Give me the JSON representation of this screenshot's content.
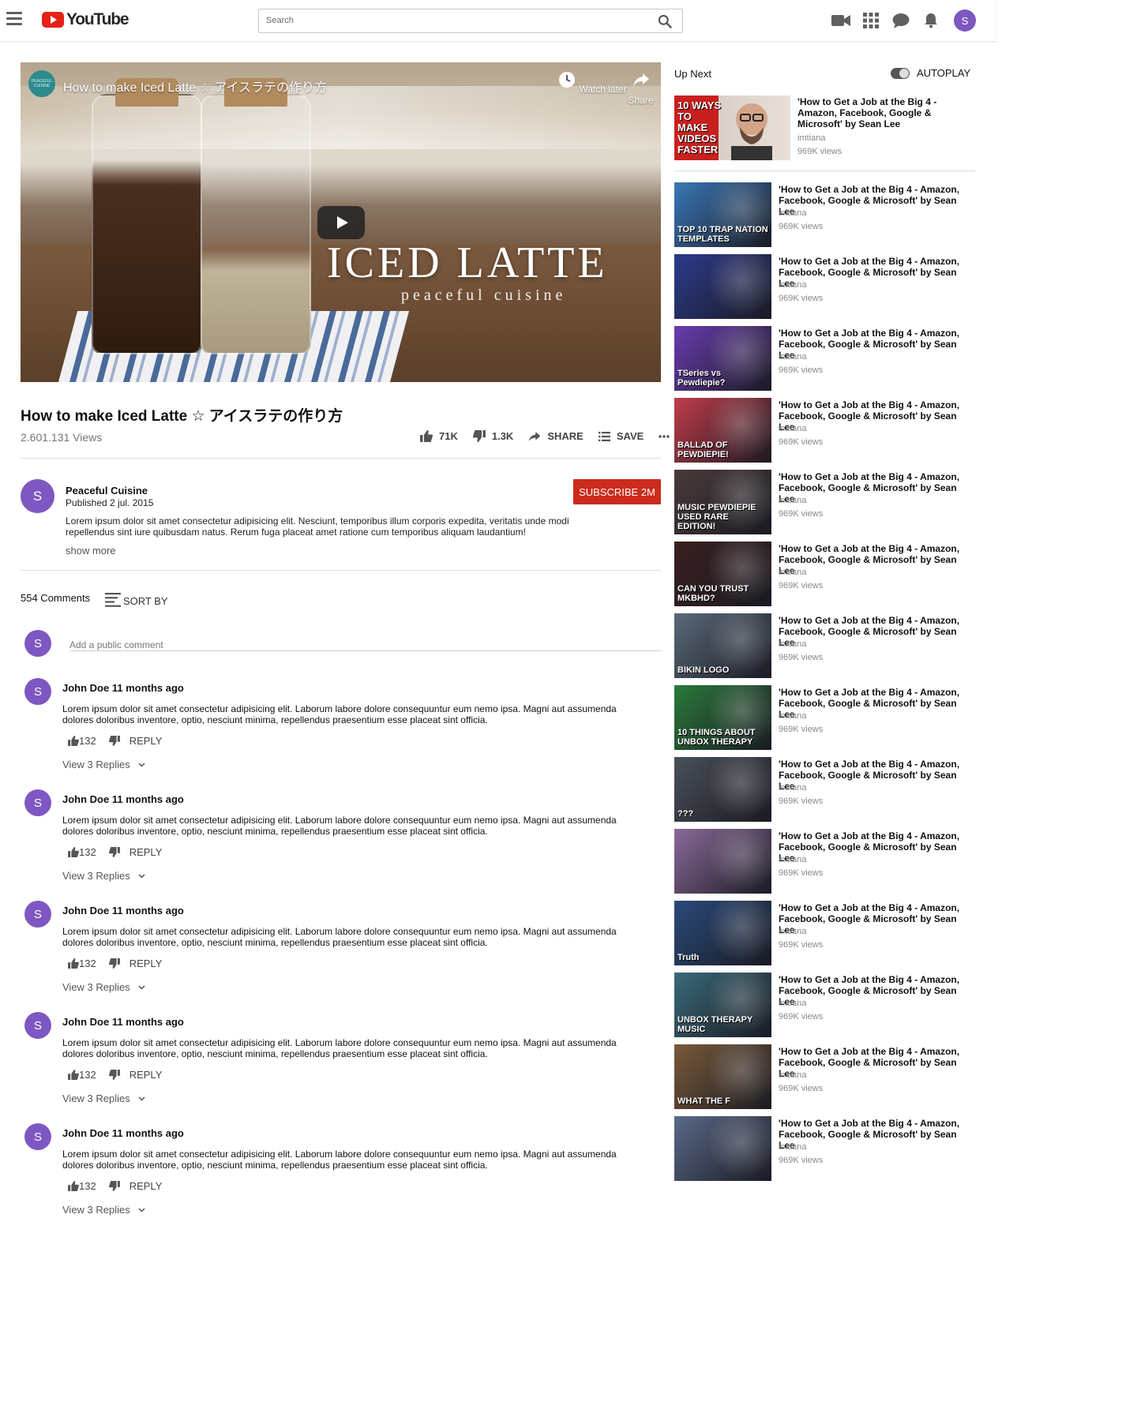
{
  "header": {
    "logo_text": "YouTube",
    "search_placeholder": "Search",
    "avatar_letter": "S",
    "icons": [
      "menu-icon",
      "video-camera-icon",
      "apps-grid-icon",
      "chat-icon",
      "bell-icon"
    ]
  },
  "player": {
    "channel_logo_text": "PEACEFUL CUISINE",
    "title": "How to make Iced Latte ☆ アイスラテの作り方",
    "watch_later": "Watch later",
    "share": "Share",
    "overlay_title": "ICED LATTE",
    "overlay_subtitle": "peaceful cuisine"
  },
  "video": {
    "title": "How to make Iced Latte ☆ アイスラテの作り方",
    "views": "2.601.131 Views",
    "likes": "71K",
    "dislikes": "1.3K",
    "share_label": "SHARE",
    "save_label": "SAVE"
  },
  "channel": {
    "avatar_letter": "S",
    "name": "Peaceful Cuisine",
    "published": "Published 2 jul. 2015",
    "description": "Lorem ipsum dolor sit amet consectetur adipisicing elit. Nesciunt, temporibus illum corporis expedita, veritatis unde modi repellendus sint iure quibusdam natus. Rerum fuga placeat amet ratione cum temporibus aliquam laudantium!",
    "show_more": "show more",
    "subscribe_label": "SUBSCRIBE 2M"
  },
  "comments": {
    "count_label": "554 Comments",
    "sort_label": "SORT BY",
    "add_placeholder": "Add a public comment",
    "user_avatar_letter": "S",
    "items": [
      {
        "avatar": "S",
        "author": "John Doe 11 months ago",
        "text": "Lorem ipsum dolor sit amet consectetur adipisicing elit. Laborum labore dolore consequuntur eum nemo ipsa. Magni aut assumenda dolores doloribus inventore, optio, nesciunt minima, repellendus praesentium esse placeat sint officia.",
        "likes": "132",
        "reply": "REPLY",
        "view_replies": "View 3 Replies"
      },
      {
        "avatar": "S",
        "author": "John Doe 11 months ago",
        "text": "Lorem ipsum dolor sit amet consectetur adipisicing elit. Laborum labore dolore consequuntur eum nemo ipsa. Magni aut assumenda dolores doloribus inventore, optio, nesciunt minima, repellendus praesentium esse placeat sint officia.",
        "likes": "132",
        "reply": "REPLY",
        "view_replies": "View 3 Replies"
      },
      {
        "avatar": "S",
        "author": "John Doe 11 months ago",
        "text": "Lorem ipsum dolor sit amet consectetur adipisicing elit. Laborum labore dolore consequuntur eum nemo ipsa. Magni aut assumenda dolores doloribus inventore, optio, nesciunt minima, repellendus praesentium esse placeat sint officia.",
        "likes": "132",
        "reply": "REPLY",
        "view_replies": "View 3 Replies"
      },
      {
        "avatar": "S",
        "author": "John Doe 11 months ago",
        "text": "Lorem ipsum dolor sit amet consectetur adipisicing elit. Laborum labore dolore consequuntur eum nemo ipsa. Magni aut assumenda dolores doloribus inventore, optio, nesciunt minima, repellendus praesentium esse placeat sint officia.",
        "likes": "132",
        "reply": "REPLY",
        "view_replies": "View 3 Replies"
      },
      {
        "avatar": "S",
        "author": "John Doe 11 months ago",
        "text": "Lorem ipsum dolor sit amet consectetur adipisicing elit. Laborum labore dolore consequuntur eum nemo ipsa. Magni aut assumenda dolores doloribus inventore, optio, nesciunt minima, repellendus praesentium esse placeat sint officia.",
        "likes": "132",
        "reply": "REPLY",
        "view_replies": "View 3 Replies"
      }
    ]
  },
  "sidebar": {
    "up_next": "Up Next",
    "autoplay": "AUTOPLAY",
    "autoplay_on": true,
    "first": {
      "thumb_label": "10 WAYS TO MAKE VIDEOS FASTER",
      "title": "'How to Get a Job at the Big 4 - Amazon, Facebook, Google & Microsoft' by Sean Lee",
      "channel": "imtiana",
      "views": "969K views"
    },
    "items": [
      {
        "thumb_label": "TOP 10 TRAP NATION TEMPLATES",
        "thumb_color": "#3a78b8",
        "title": "'How to Get a Job at the Big 4 - Amazon, Facebook, Google & Microsoft' by Sean Lee",
        "channel": "imtiana",
        "views": "969K views"
      },
      {
        "thumb_label": "",
        "thumb_color": "#2c3a8c",
        "title": "'How to Get a Job at the Big 4 - Amazon, Facebook, Google & Microsoft' by Sean Lee",
        "channel": "imtiana",
        "views": "969K views"
      },
      {
        "thumb_label": "TSeries vs Pewdiepie?",
        "thumb_color": "#6a3cb0",
        "title": "'How to Get a Job at the Big 4 - Amazon, Facebook, Google & Microsoft' by Sean Lee",
        "channel": "imtiana",
        "views": "969K views"
      },
      {
        "thumb_label": "BALLAD OF PEWDIEPIE!",
        "thumb_color": "#c23c4a",
        "title": "'How to Get a Job at the Big 4 - Amazon, Facebook, Google & Microsoft' by Sean Lee",
        "channel": "imtiana",
        "views": "969K views"
      },
      {
        "thumb_label": "MUSIC PEWDIEPIE USED RARE EDITION!",
        "thumb_color": "#4a3a3a",
        "title": "'How to Get a Job at the Big 4 - Amazon, Facebook, Google & Microsoft' by Sean Lee",
        "channel": "imtiana",
        "views": "969K views"
      },
      {
        "thumb_label": "CAN YOU TRUST MKBHD?",
        "thumb_color": "#3a2020",
        "title": "'How to Get a Job at the Big 4 - Amazon, Facebook, Google & Microsoft' by Sean Lee",
        "channel": "imtiana",
        "views": "969K views"
      },
      {
        "thumb_label": "BIKIN LOGO",
        "thumb_color": "#5a6a7a",
        "title": "'How to Get a Job at the Big 4 - Amazon, Facebook, Google & Microsoft' by Sean Lee",
        "channel": "imtiana",
        "views": "969K views"
      },
      {
        "thumb_label": "10 THINGS ABOUT UNBOX THERAPY",
        "thumb_color": "#2a7a3a",
        "title": "'How to Get a Job at the Big 4 - Amazon, Facebook, Google & Microsoft' by Sean Lee",
        "channel": "imtiana",
        "views": "969K views"
      },
      {
        "thumb_label": "???",
        "thumb_color": "#4a5058",
        "title": "'How to Get a Job at the Big 4 - Amazon, Facebook, Google & Microsoft' by Sean Lee",
        "channel": "imtiana",
        "views": "969K views"
      },
      {
        "thumb_label": "",
        "thumb_color": "#8a6a9a",
        "title": "'How to Get a Job at the Big 4 - Amazon, Facebook, Google & Microsoft' by Sean Lee",
        "channel": "imtiana",
        "views": "969K views"
      },
      {
        "thumb_label": "Truth",
        "thumb_color": "#2a4a7a",
        "title": "'How to Get a Job at the Big 4 - Amazon, Facebook, Google & Microsoft' by Sean Lee",
        "channel": "imtiana",
        "views": "969K views"
      },
      {
        "thumb_label": "UNBOX THERAPY MUSIC",
        "thumb_color": "#3a6a7a",
        "title": "'How to Get a Job at the Big 4 - Amazon, Facebook, Google & Microsoft' by Sean Lee",
        "channel": "imtiana",
        "views": "969K views"
      },
      {
        "thumb_label": "WHAT THE F",
        "thumb_color": "#7a5a3a",
        "title": "'How to Get a Job at the Big 4 - Amazon, Facebook, Google & Microsoft' by Sean Lee",
        "channel": "imtiana",
        "views": "969K views"
      },
      {
        "thumb_label": "",
        "thumb_color": "#5a6a8a",
        "title": "'How to Get a Job at the Big 4 - Amazon, Facebook, Google & Microsoft' by Sean Lee",
        "channel": "imtiana",
        "views": "969K views"
      }
    ]
  },
  "colors": {
    "brand_red": "#e62117",
    "subscribe_red": "#cc2b1d",
    "avatar_purple": "#7e57c2"
  }
}
